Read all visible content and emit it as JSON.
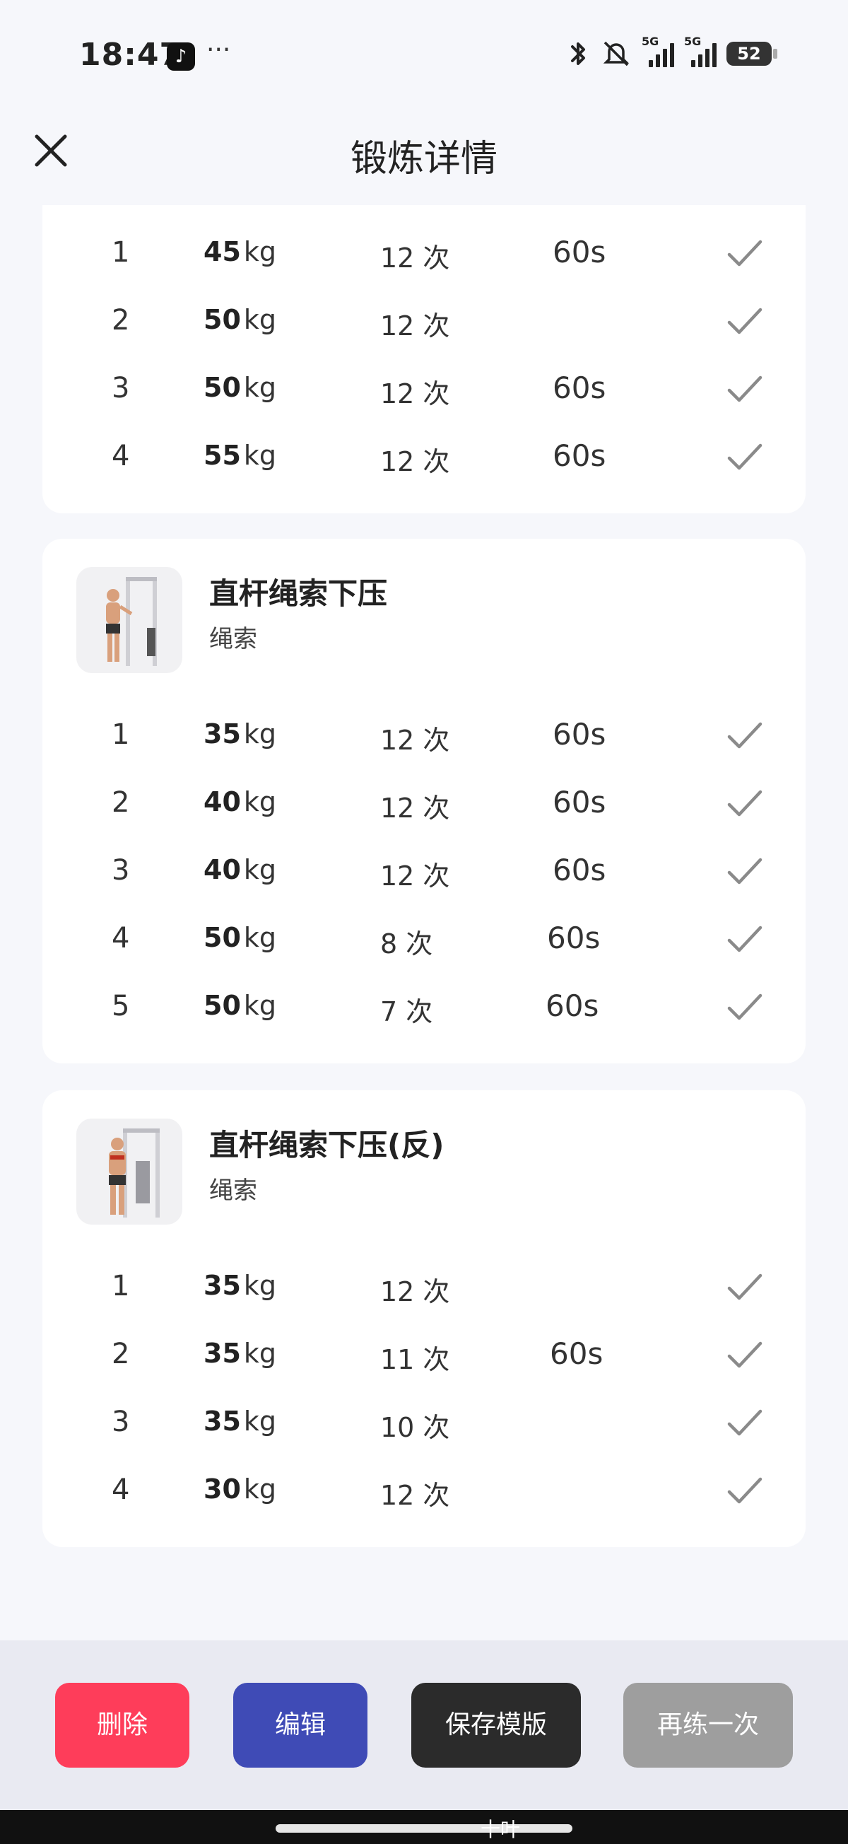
{
  "status": {
    "time": "18:47",
    "tiktok_glyph": "♪",
    "more": "···",
    "signal1_tag": "5G",
    "signal2_tag": "5G",
    "battery": "52"
  },
  "header": {
    "title": "锻炼详情",
    "close_icon": "close-icon"
  },
  "unit_kg": "kg",
  "exercises": [
    {
      "sets": [
        {
          "idx": "1",
          "weight": "45",
          "reps": "12 次",
          "rest": "60s"
        },
        {
          "idx": "2",
          "weight": "50",
          "reps": "12 次",
          "rest": ""
        },
        {
          "idx": "3",
          "weight": "50",
          "reps": "12 次",
          "rest": "60s"
        },
        {
          "idx": "4",
          "weight": "55",
          "reps": "12 次",
          "rest": "60s"
        }
      ]
    },
    {
      "name": "直杆绳索下压",
      "equipment": "绳索",
      "sets": [
        {
          "idx": "1",
          "weight": "35",
          "reps": "12 次",
          "rest": "60s"
        },
        {
          "idx": "2",
          "weight": "40",
          "reps": "12 次",
          "rest": "60s"
        },
        {
          "idx": "3",
          "weight": "40",
          "reps": "12 次",
          "rest": "60s"
        },
        {
          "idx": "4",
          "weight": "50",
          "reps": "8 次",
          "rest": "60s"
        },
        {
          "idx": "5",
          "weight": "50",
          "reps": "7 次",
          "rest": "60s"
        }
      ]
    },
    {
      "name": "直杆绳索下压(反)",
      "equipment": "绳索",
      "sets": [
        {
          "idx": "1",
          "weight": "35",
          "reps": "12 次",
          "rest": ""
        },
        {
          "idx": "2",
          "weight": "35",
          "reps": "11 次",
          "rest": "60s"
        },
        {
          "idx": "3",
          "weight": "35",
          "reps": "10 次",
          "rest": ""
        },
        {
          "idx": "4",
          "weight": "30",
          "reps": "12 次",
          "rest": ""
        }
      ]
    }
  ],
  "buttons": {
    "delete": "删除",
    "edit": "编辑",
    "save_template": "保存模版",
    "again": "再练一次"
  },
  "colors": {
    "delete": "#fe3d5a",
    "edit": "#3f4bb6",
    "save_template": "#2b2b2b",
    "again": "#9e9e9e",
    "check": "#8a8a8a"
  },
  "nav_text": "十叶"
}
